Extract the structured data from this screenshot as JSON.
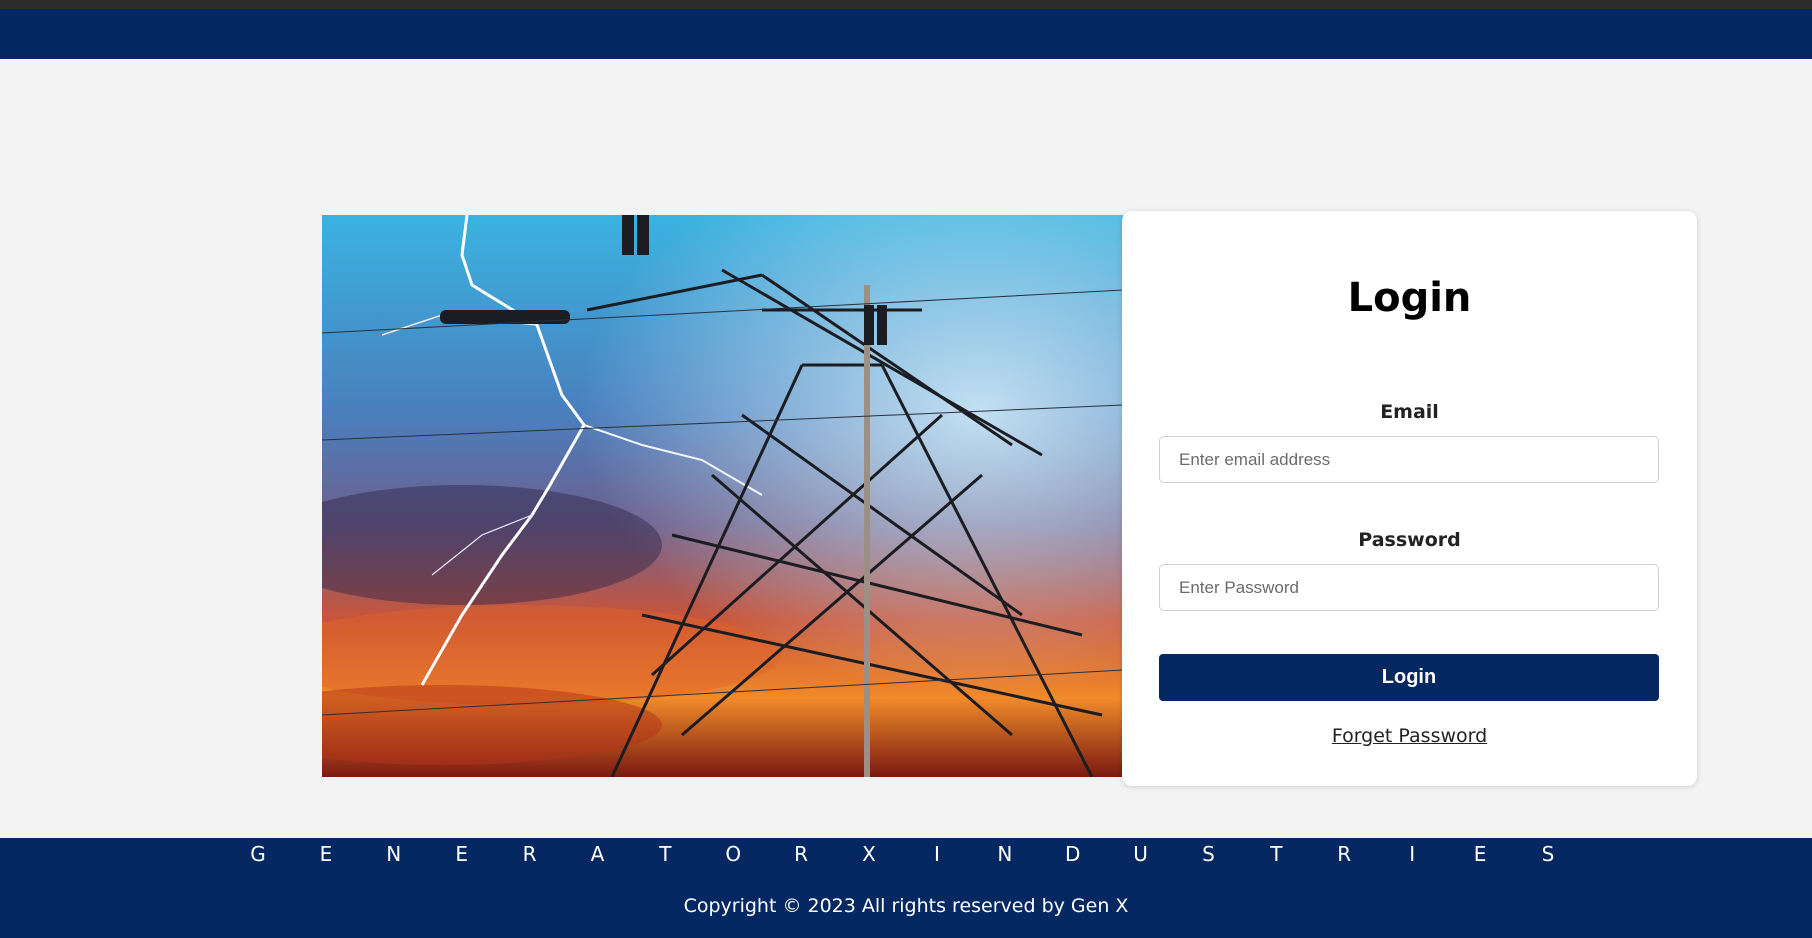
{
  "login": {
    "title": "Login",
    "email_label": "Email",
    "email_placeholder": "Enter email address",
    "password_label": "Password",
    "password_placeholder": "Enter Password",
    "submit_label": "Login",
    "forgot_label": "Forget Password"
  },
  "footer": {
    "brand_letters": [
      "G",
      "E",
      "N",
      "E",
      "R",
      "A",
      "T",
      "O",
      "R",
      "X",
      "I",
      "N",
      "D",
      "U",
      "S",
      "T",
      "R",
      "I",
      "E",
      "S"
    ],
    "copyright": "Copyright © 2023 All rights reserved by Gen X"
  },
  "colors": {
    "brand_navy": "#052862",
    "background": "#f3f3f3"
  },
  "icons": {
    "hero_image": "power-tower-lightning-icon"
  }
}
